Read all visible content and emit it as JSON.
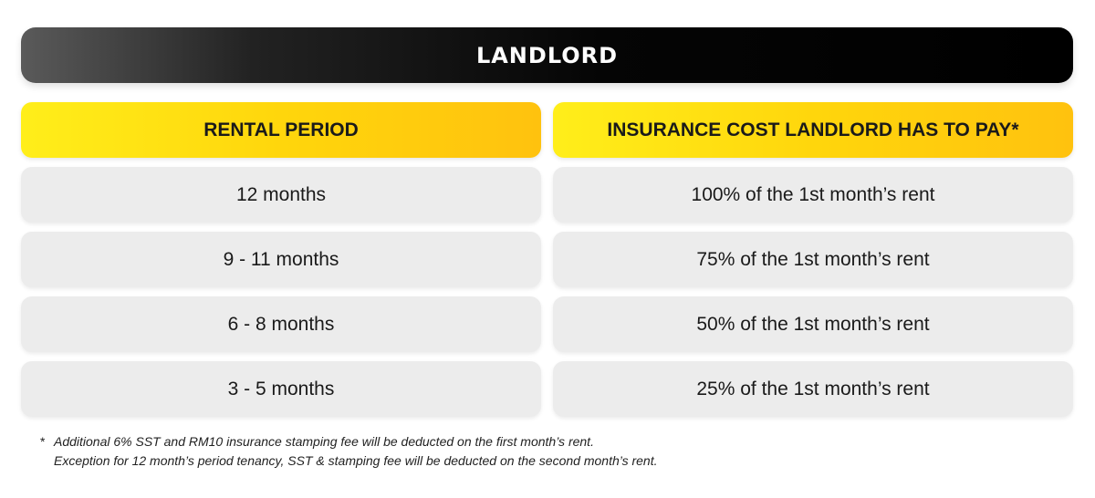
{
  "banner": {
    "title": "LANDLORD"
  },
  "table": {
    "headers": [
      "RENTAL PERIOD",
      "INSURANCE COST LANDLORD HAS TO PAY*"
    ],
    "rows": [
      [
        "12 months",
        "100% of the 1st month’s rent"
      ],
      [
        "9 - 11 months",
        "75% of the 1st month’s rent"
      ],
      [
        "6 - 8 months",
        "50% of the 1st month’s rent"
      ],
      [
        "3 - 5 months",
        "25% of the 1st month’s rent"
      ]
    ]
  },
  "footnote": {
    "marker": "*",
    "line1": "Additional 6% SST and RM10 insurance stamping fee will be deducted on the first month’s rent.",
    "line2": "Exception for 12 month’s period tenancy, SST & stamping fee will be deducted on the second month’s rent."
  },
  "colors": {
    "header_yellow": "#ffd60c",
    "banner_black": "#000000",
    "cell_grey": "#ececec"
  }
}
